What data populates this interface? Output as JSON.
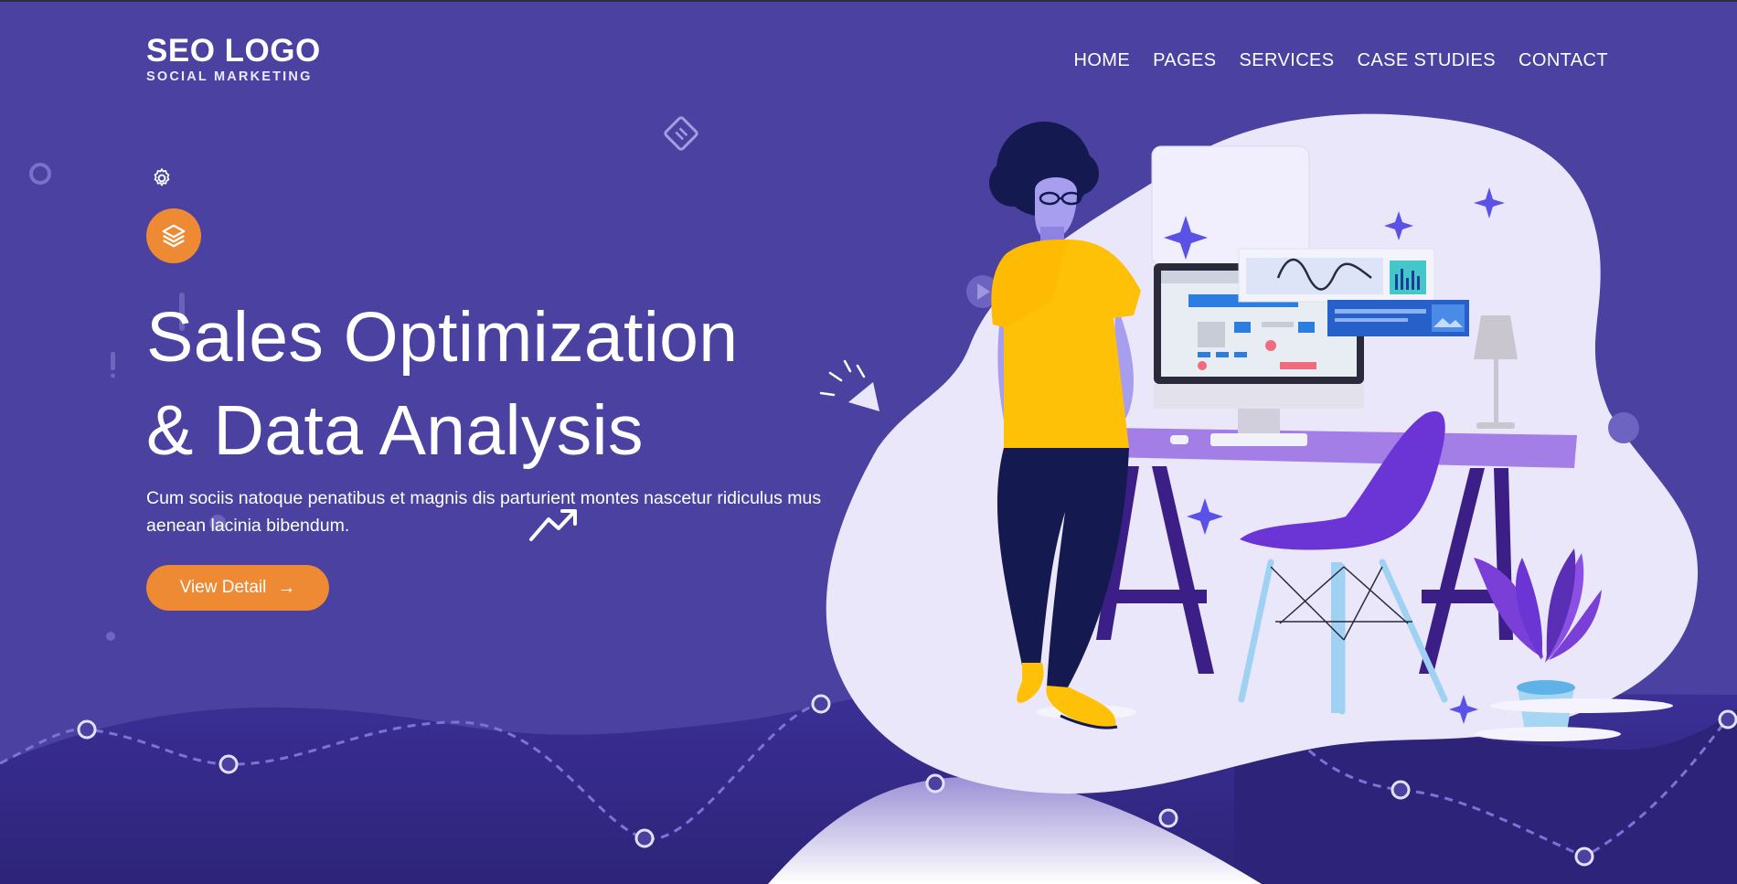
{
  "logo": {
    "main": "SEO LOGO",
    "sub": "SOCIAL MARKETING"
  },
  "nav": {
    "items": [
      {
        "label": "HOME"
      },
      {
        "label": "PAGES"
      },
      {
        "label": "SERVICES"
      },
      {
        "label": "CASE STUDIES"
      },
      {
        "label": "CONTACT"
      }
    ]
  },
  "hero": {
    "title_line1": "Sales Optimization",
    "title_line2": "& Data Analysis",
    "description": "Cum sociis natoque penatibus et magnis dis parturient montes nascetur ridiculus mus aenean lacinia bibendum.",
    "cta_label": "View Detail",
    "cta_icon": "arrow-right-icon",
    "badge_icon": "layers-icon"
  },
  "colors": {
    "background": "#4a41a1",
    "accent": "#ed8a33",
    "blob": "#ebe7fb",
    "shirt": "#ffc107",
    "chair": "#6a35d4",
    "desk": "#a27ee6"
  }
}
